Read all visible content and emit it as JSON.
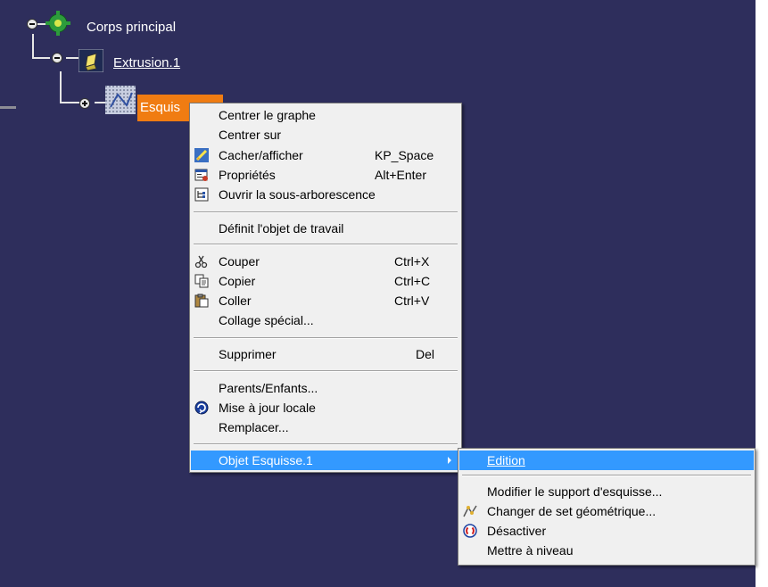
{
  "tree": {
    "root_label": "Corps principal",
    "child_label": "Extrusion.1",
    "grandchild_label": "Esquis"
  },
  "context_menu": {
    "items": [
      {
        "label": "Centrer le graphe",
        "shortcut": ""
      },
      {
        "label": "Centrer sur",
        "shortcut": ""
      },
      {
        "label": "Cacher/afficher",
        "shortcut": "KP_Space",
        "icon": "hide-show-icon"
      },
      {
        "label": "Propriétés",
        "shortcut": "Alt+Enter",
        "icon": "properties-icon"
      },
      {
        "label": "Ouvrir la sous-arborescence",
        "shortcut": "",
        "icon": "subtree-icon"
      },
      {
        "label": "Définit l'objet de travail",
        "shortcut": ""
      },
      {
        "label": "Couper",
        "shortcut": "Ctrl+X",
        "icon": "cut-icon"
      },
      {
        "label": "Copier",
        "shortcut": "Ctrl+C",
        "icon": "copy-icon"
      },
      {
        "label": "Coller",
        "shortcut": "Ctrl+V",
        "icon": "paste-icon"
      },
      {
        "label": "Collage spécial...",
        "shortcut": ""
      },
      {
        "label": "Supprimer",
        "shortcut": "Del"
      },
      {
        "label": "Parents/Enfants...",
        "shortcut": ""
      },
      {
        "label": "Mise à jour locale",
        "shortcut": "",
        "icon": "update-icon"
      },
      {
        "label": "Remplacer...",
        "shortcut": ""
      },
      {
        "label": "Objet Esquisse.1",
        "shortcut": "",
        "submenu": true
      }
    ]
  },
  "submenu": {
    "items": [
      {
        "label": "Edition"
      },
      {
        "label": "Modifier le support d'esquisse..."
      },
      {
        "label": "Changer de set géométrique...",
        "icon": "change-set-icon"
      },
      {
        "label": "Désactiver",
        "icon": "deactivate-icon"
      },
      {
        "label": "Mettre à niveau"
      }
    ]
  },
  "colors": {
    "background": "#2e2e5c",
    "selection": "#f07c12",
    "menu_highlight": "#3399ff"
  }
}
